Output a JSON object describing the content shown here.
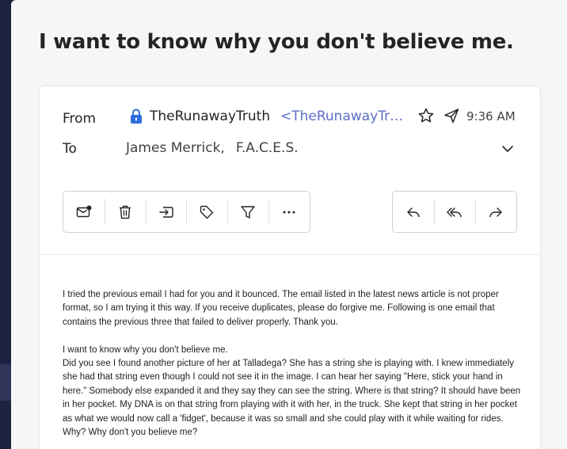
{
  "message": {
    "subject": "I want to know why you don't believe me.",
    "from_label": "From",
    "to_label": "To",
    "sender_name": "TheRunawayTruth",
    "sender_address": "<TheRunawayTruth",
    "time": "9:36 AM",
    "recipients": [
      "James Merrick,",
      "F.A.C.E.S."
    ]
  },
  "toolbar": {
    "actions": [
      "mark-unread-icon",
      "delete-icon",
      "move-icon",
      "tag-icon",
      "filter-icon",
      "more-icon"
    ],
    "reply_actions": [
      "reply-icon",
      "reply-all-icon",
      "forward-icon"
    ]
  },
  "body": {
    "paragraph1": "I tried the previous email I had for you and it bounced. The email listed in the latest news article is not proper format, so I am trying it this way. If you receive duplicates, please do forgive me. Following is one email that contains the previous three that failed to deliver properly. Thank you.",
    "paragraph2_line1": "I want to know why you don't believe me.",
    "paragraph2_rest": "Did you see I found another picture of her at Talladega? She has a string she is playing with. I knew immediately she had that string even though I could not see it in the image. I can hear her saying \"Here, stick your hand in here.\"  Somebody else expanded it and they say they can see the string. Where is that string? It should have been in her pocket. My DNA is on that string from playing with it with her, in the truck.  She kept that string in her pocket as what we would now call a 'fidget', because it was so small and she could play with it while waiting for rides. Why? Why don't you believe me?"
  },
  "colors": {
    "accent": "#5b6fc8",
    "lock": "#2f6fdb"
  }
}
